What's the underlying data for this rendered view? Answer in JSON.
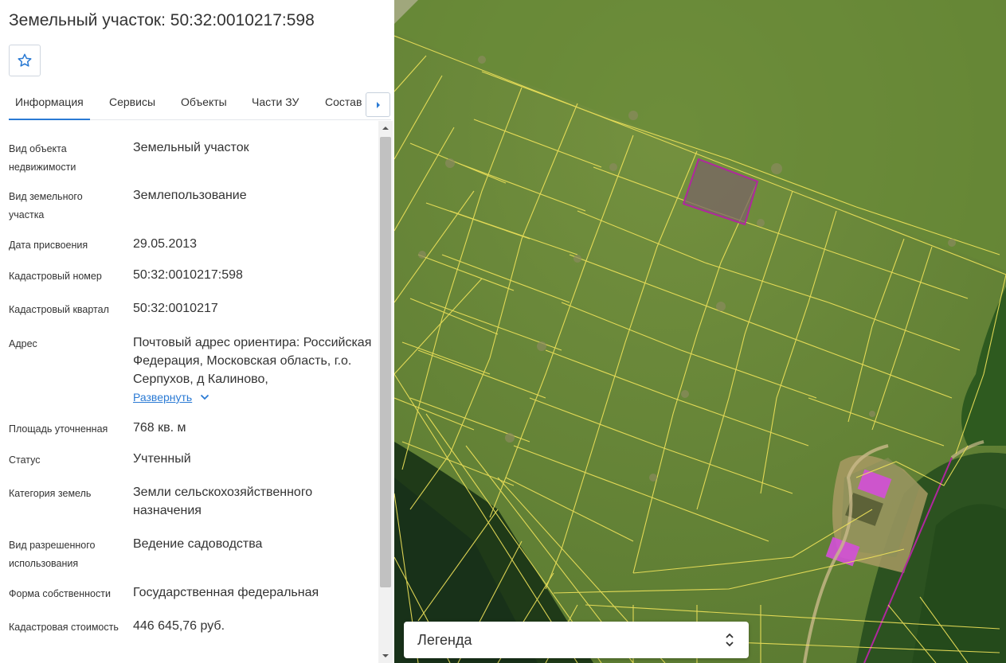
{
  "header": {
    "title": "Земельный участок: 50:32:0010217:598"
  },
  "tabs": [
    "Информация",
    "Сервисы",
    "Объекты",
    "Части ЗУ",
    "Состав"
  ],
  "info": {
    "object_type": {
      "label": "Вид объекта недвижимости",
      "value": "Земельный участок"
    },
    "land_type": {
      "label": "Вид земельного участка",
      "value": "Землепользование"
    },
    "assign_date": {
      "label": "Дата присвоения",
      "value": "29.05.2013"
    },
    "cadastral_number": {
      "label": "Кадастровый номер",
      "value": "50:32:0010217:598"
    },
    "cadastral_quarter": {
      "label": "Кадастровый квартал",
      "value": "50:32:0010217"
    },
    "address": {
      "label": "Адрес",
      "value": "Почтовый адрес ориентира: Российская Федерация, Московская область, г.о. Серпухов, д Калиново,",
      "expand_label": "Развернуть"
    },
    "area": {
      "label": "Площадь уточненная",
      "value": "768 кв. м"
    },
    "status": {
      "label": "Статус",
      "value": "Учтенный"
    },
    "land_category": {
      "label": "Категория земель",
      "value": "Земли сельскохозяйственного назначения"
    },
    "permitted_use": {
      "label": "Вид разрешенного использования",
      "value": "Ведение садоводства"
    },
    "ownership": {
      "label": "Форма собственности",
      "value": "Государственная федеральная"
    },
    "cadastral_value": {
      "label": "Кадастровая стоимость",
      "value": "446 645,76 руб."
    }
  },
  "map": {
    "legend_label": "Легенда"
  },
  "colors": {
    "accent": "#2a7ad4",
    "parcel_border": "#f0e35a",
    "selected_parcel": "#b0279e",
    "building": "#d44fd8"
  }
}
